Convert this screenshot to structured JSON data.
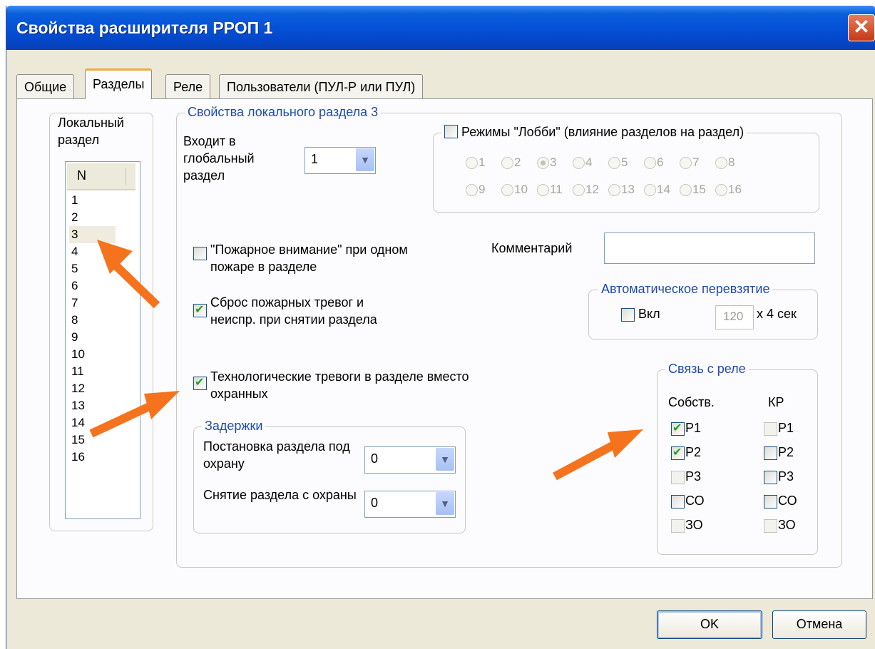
{
  "window": {
    "title": "Свойства расширителя РРОП 1",
    "close_glyph": "✕"
  },
  "tabs": [
    {
      "label": "Общие"
    },
    {
      "label": "Разделы"
    },
    {
      "label": "Реле"
    },
    {
      "label": "Пользователи (ПУЛ-Р или ПУЛ)"
    }
  ],
  "local": {
    "label": "Локальный раздел",
    "header": "N",
    "items": [
      "1",
      "2",
      "3",
      "4",
      "5",
      "6",
      "7",
      "8",
      "9",
      "10",
      "11",
      "12",
      "13",
      "14",
      "15",
      "16"
    ],
    "selected": "3"
  },
  "props": {
    "legend": "Свойства локального раздела 3",
    "global_label": "Входит в глобальный раздел",
    "global_value": "1",
    "fire_attention": "\"Пожарное внимание\" при одном пожаре  в разделе",
    "reset_alarms": "Сброс пожарных тревог и неиспр. при снятии раздела",
    "tech_alarms": "Технологические тревоги в разделе вместо охранных",
    "lobby_label": "Режимы \"Лобби\" (влияние разделов на раздел)",
    "lobby_radios": [
      "1",
      "2",
      "3",
      "4",
      "5",
      "6",
      "7",
      "8",
      "9",
      "10",
      "11",
      "12",
      "13",
      "14",
      "15",
      "16"
    ],
    "lobby_selected": "3",
    "comment_label": "Комментарий",
    "comment_value": "",
    "auto": {
      "legend": "Автоматическое перевзятие",
      "on_label": "Вкл",
      "value": "120",
      "unit": "x 4 сек"
    },
    "delays": {
      "legend": "Задержки",
      "arm_label": "Постановка раздела под охрану",
      "arm_value": "0",
      "disarm_label": "Снятие раздела с охраны",
      "disarm_value": "0"
    },
    "relay": {
      "legend": "Связь с реле",
      "own_header": "Собств.",
      "kr_header": "КР",
      "own": [
        {
          "label": "Р1",
          "checked": true
        },
        {
          "label": "Р2",
          "checked": true
        },
        {
          "label": "Р3",
          "checked": false
        },
        {
          "label": "СО",
          "checked": false
        },
        {
          "label": "ЗО",
          "checked": false
        }
      ],
      "kr": [
        {
          "label": "Р1"
        },
        {
          "label": "Р2"
        },
        {
          "label": "Р3"
        },
        {
          "label": "СО"
        },
        {
          "label": "ЗО"
        }
      ]
    }
  },
  "buttons": {
    "ok": "OK",
    "cancel": "Отмена"
  },
  "colors": {
    "title_bar": "#0551d6",
    "legend_text": "#1f4aa8",
    "annotation_arrow": "#f5731d",
    "check_green": "#21a121"
  }
}
